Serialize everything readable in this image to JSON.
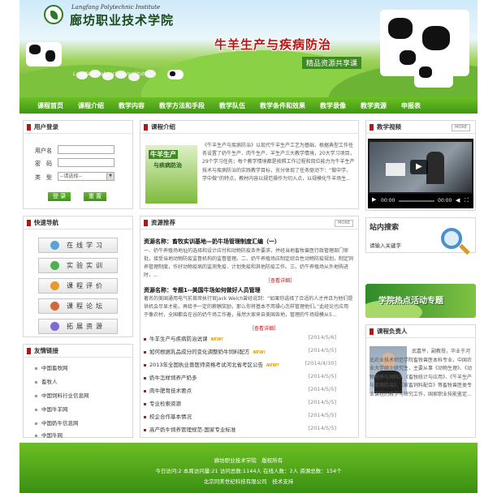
{
  "header": {
    "school_en": "Langfang Polytechnic Institute",
    "school_cn": "廊坊职业技术学院",
    "course_title": "牛羊生产与疾病防治",
    "course_subtitle": "精品资源共享课",
    "banner_en": "Langfang Polytechnic Institute"
  },
  "nav": [
    "课程首页",
    "课程介绍",
    "教学内容",
    "教学方法和手段",
    "教学队伍",
    "教学条件和效果",
    "教学录像",
    "教学资源",
    "申报表"
  ],
  "login": {
    "title": "用户登录",
    "user_label": "用户名",
    "pass_label": "密　码",
    "type_label": "类　型",
    "type_value": "--请选择--",
    "login_btn": "登 录",
    "reset_btn": "重 置"
  },
  "quick_nav": {
    "title": "快速导航",
    "items": [
      "在线学习",
      "实验实训",
      "课程评价",
      "课程论坛",
      "拓展资源"
    ]
  },
  "links": {
    "title": "友情链接",
    "items": [
      "中国畜牧网",
      "畜牧人",
      "中国饲料行业信息网",
      "中国牛羊网",
      "中国奶牛信息网",
      "中国牛网"
    ]
  },
  "intro": {
    "title": "课程介绍",
    "thumb_line1": "牛羊生产",
    "thumb_line2": "与疾病防治",
    "text": "《牛羊生产与疾病防治》以现代牛羊生产工艺为基础，根据典型工作任务设置了奶牛生产、肉牛生产、羊生产三大教学情境，20大学习项目，29个学习任务；每个教学情境都是按照工作过程和岗位能力为牛羊生产技术与疾病防治的实践教学目标，充分体现了任务驱动下：“做中学，学中做”的特点，教材内容以规范操作为切入点，以规模化牛羊场生..."
  },
  "video": {
    "title": "教学视频",
    "time_a": "00:00",
    "time_b": "00:00"
  },
  "resources": {
    "title": "资源推荐",
    "a1_title": "资源名称：畜牧实训基地—奶牛场管理制度汇编（一）",
    "a1_text": "一、奶牛养殖场地址的选择和设计应付和动物防疫条件要求，并经当地畜牧兽医行政管理部门审批，接受当地动物防疫监督机构的监督管理。二、奶牛养殖场应制定综合性动物防疫规划，制定饲养管理制度，作好动物疫病的监测免疫、计划免疫和其他防疫工作。三、奶牛养殖场从外地购进时，...",
    "a2_title": "资源名称：专题1--美国牛场如何做好人员管理",
    "a2_text": "著名的美国通用电气前首席执行官Jack Welch曾经说到：“如果你选择了合适的人才并且为他们提供机会尽显才能，再给予一定的薪酬奖励，那么你将基本不用操心怎样管理他们。”此经论也应用于像农村，全国都会在谷的奶牛场工作着，虽然大家来自美国各地，管理的牛场规模从5...",
    "detail": "［查看详细］",
    "new_label": "NEW!",
    "news": [
      {
        "title": "牛羊生产与疾病防治说课",
        "date": "[2014/5/6]",
        "new": true
      },
      {
        "title": "如何根据乳品成分的变化调整奶牛饲料配方",
        "date": "[2014/5/5]",
        "new": true
      },
      {
        "title": "2013年全国执业兽医师资格考试河北省考区公告",
        "date": "[2014/4/30]",
        "new": true
      },
      {
        "title": "奶牛怎样饲养产奶多",
        "date": "[2014/5/5]",
        "new": false
      },
      {
        "title": "肉牛肥育技术要点",
        "date": "[2014/5/5]",
        "new": false
      },
      {
        "title": "专业检索资源",
        "date": "[2014/5/5]",
        "new": false
      },
      {
        "title": "校企合作基本情况",
        "date": "[2014/5/5]",
        "new": false
      },
      {
        "title": "高产奶牛饲养管理规范-国家专业标准",
        "date": "[2014/5/5]",
        "new": false
      }
    ]
  },
  "search": {
    "title": "站内搜索",
    "placeholder": "请输入关键字"
  },
  "activity": {
    "title": "学院热点活动专题"
  },
  "leader": {
    "title": "课程负责人",
    "text": "武嘉平，副教授，毕业于河北农业技术师范学院畜牧兽医本科专业，中国农业大学硕士研究生，主要从事《动物生理》、《动物营养与饲料》、《畜牧统计与应用》、《牛羊生产与疾病防治》、《家畜饲料配合》等畜牧兽医类专业课程的教学与研究工作，国家职业技能鉴定..."
  },
  "footer": {
    "line1": "廊坊职业技术学院　版权所有",
    "line2": "今日访问:2  本周访问量:21  访问总数:1144人  在线人数：2人  资源总数：154个",
    "line3": "北京同美世纪科技有限公司　技术支持"
  },
  "colors": {
    "nav_green": "#4ea91b",
    "title_red": "#c01010"
  }
}
